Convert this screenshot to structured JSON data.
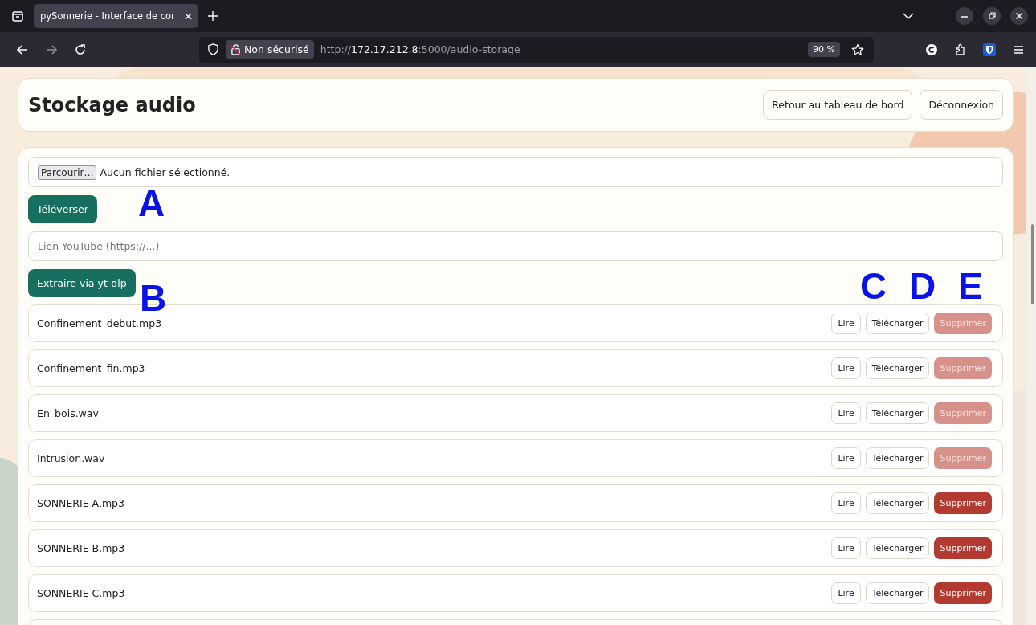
{
  "browser": {
    "tab_title": "pySonnerie - Interface de cor",
    "security": "Non sécurisé",
    "url_prefix": "http://",
    "url_host": "172.17.212.8",
    "url_path": ":5000/audio-storage",
    "zoom": "90 %"
  },
  "header": {
    "title": "Stockage audio",
    "buttons": [
      "Retour au tableau de bord",
      "Déconnexion"
    ]
  },
  "upload": {
    "browse_button": "Parcourir…",
    "file_status": "Aucun fichier sélectionné.",
    "submit": "Téléverser"
  },
  "youtube": {
    "placeholder": "Lien YouTube (https://...)",
    "submit": "Extraire via yt-dlp"
  },
  "files": [
    {
      "name": "Confinement_debut.mp3",
      "play": "Lire",
      "download": "Télécharger",
      "delete": "Supprimer",
      "delete_disabled": true
    },
    {
      "name": "Confinement_fin.mp3",
      "play": "Lire",
      "download": "Télécharger",
      "delete": "Supprimer",
      "delete_disabled": true
    },
    {
      "name": "En_bois.wav",
      "play": "Lire",
      "download": "Télécharger",
      "delete": "Supprimer",
      "delete_disabled": true
    },
    {
      "name": "Intrusion.wav",
      "play": "Lire",
      "download": "Télécharger",
      "delete": "Supprimer",
      "delete_disabled": true
    },
    {
      "name": "SONNERIE A.mp3",
      "play": "Lire",
      "download": "Télécharger",
      "delete": "Supprimer",
      "delete_disabled": false
    },
    {
      "name": "SONNERIE B.mp3",
      "play": "Lire",
      "download": "Télécharger",
      "delete": "Supprimer",
      "delete_disabled": false
    },
    {
      "name": "SONNERIE C.mp3",
      "play": "Lire",
      "download": "Télécharger",
      "delete": "Supprimer",
      "delete_disabled": false
    }
  ],
  "annotations": [
    "A",
    "B",
    "C",
    "D",
    "E"
  ]
}
